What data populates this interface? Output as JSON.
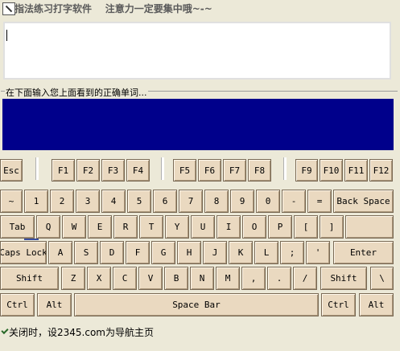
{
  "window": {
    "title": "指法练习打字软件    注意力一定要集中哦~-~"
  },
  "input": {
    "label": "在下面输入您上面看到的正确单词..."
  },
  "keyboard": {
    "fn_row": [
      "Esc",
      "F1",
      "F2",
      "F3",
      "F4",
      "F5",
      "F6",
      "F7",
      "F8",
      "F9",
      "F10",
      "F11",
      "F12"
    ],
    "row1": [
      "~",
      "1",
      "2",
      "3",
      "4",
      "5",
      "6",
      "7",
      "8",
      "9",
      "0",
      "-",
      "=",
      "Back Space"
    ],
    "row2": [
      "Tab",
      "Q",
      "W",
      "E",
      "R",
      "T",
      "Y",
      "U",
      "I",
      "O",
      "P",
      "[",
      "]"
    ],
    "row3": [
      "Caps Lock",
      "A",
      "S",
      "D",
      "F",
      "G",
      "H",
      "J",
      "K",
      "L",
      ";",
      "'",
      "Enter"
    ],
    "row4": [
      "Shift",
      "Z",
      "X",
      "C",
      "V",
      "B",
      "N",
      "M",
      ",",
      ".",
      "/",
      "Shift",
      "\\"
    ],
    "row5": [
      "Ctrl",
      "Alt",
      "Space Bar",
      "Ctrl",
      "Alt"
    ]
  },
  "status": {
    "text": "关闭时，设2345.com为导航主页"
  }
}
